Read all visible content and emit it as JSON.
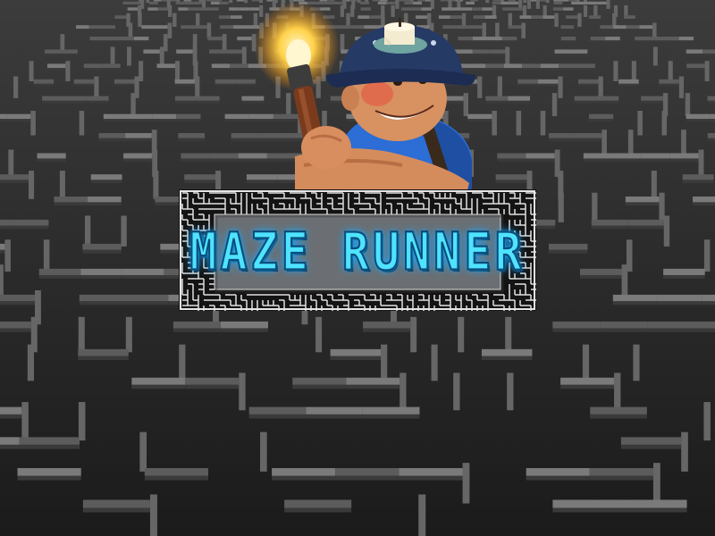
{
  "title": "MAZE RUNNER",
  "colors": {
    "title_fill": "#4fe3ff",
    "title_glow": "#1aa7ff",
    "panel_fill": "#6b6f73",
    "maze_dark": "#1f1f1f",
    "maze_wall": "#5a5a5a"
  },
  "icons": {
    "background": "stone-maze-background",
    "mascot": "miner-character",
    "torch": "torch-icon",
    "frame": "maze-border-frame"
  }
}
